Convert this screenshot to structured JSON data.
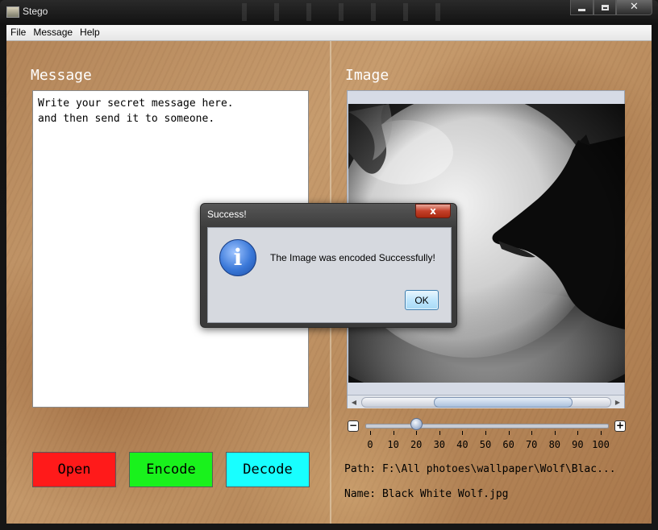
{
  "window": {
    "title": "Stego"
  },
  "menu": [
    {
      "label": "File"
    },
    {
      "label": "Message"
    },
    {
      "label": "Help"
    }
  ],
  "message_panel": {
    "heading": "Message",
    "text": "Write your secret message here.\nand then send it to someone."
  },
  "buttons": {
    "open": {
      "label": "Open",
      "color": "#ff1a1a"
    },
    "encode": {
      "label": "Encode",
      "color": "#19f21c"
    },
    "decode": {
      "label": "Decode",
      "color": "#18ffff"
    }
  },
  "image_panel": {
    "heading": "Image",
    "zoom": {
      "value": 20,
      "min": 0,
      "max": 100,
      "tick_labels": [
        "0",
        "10",
        "20",
        "30",
        "40",
        "50",
        "60",
        "70",
        "80",
        "90",
        "100"
      ],
      "minus_label": "−",
      "plus_label": "+"
    },
    "path_line": "Path: F:\\All photoes\\wallpaper\\Wolf\\Blac...",
    "name_line": "Name: Black White Wolf.jpg"
  },
  "dialog": {
    "title": "Success!",
    "message": "The Image was encoded Successfully!",
    "ok_label": "OK",
    "close_glyph": "x"
  },
  "icons": {
    "info": "info-icon",
    "close": "close-icon",
    "minimize": "minimize-icon",
    "maximize": "maximize-icon"
  },
  "colors": {
    "heading_text": "#ffffff",
    "info_icon": "#3a78d8"
  }
}
